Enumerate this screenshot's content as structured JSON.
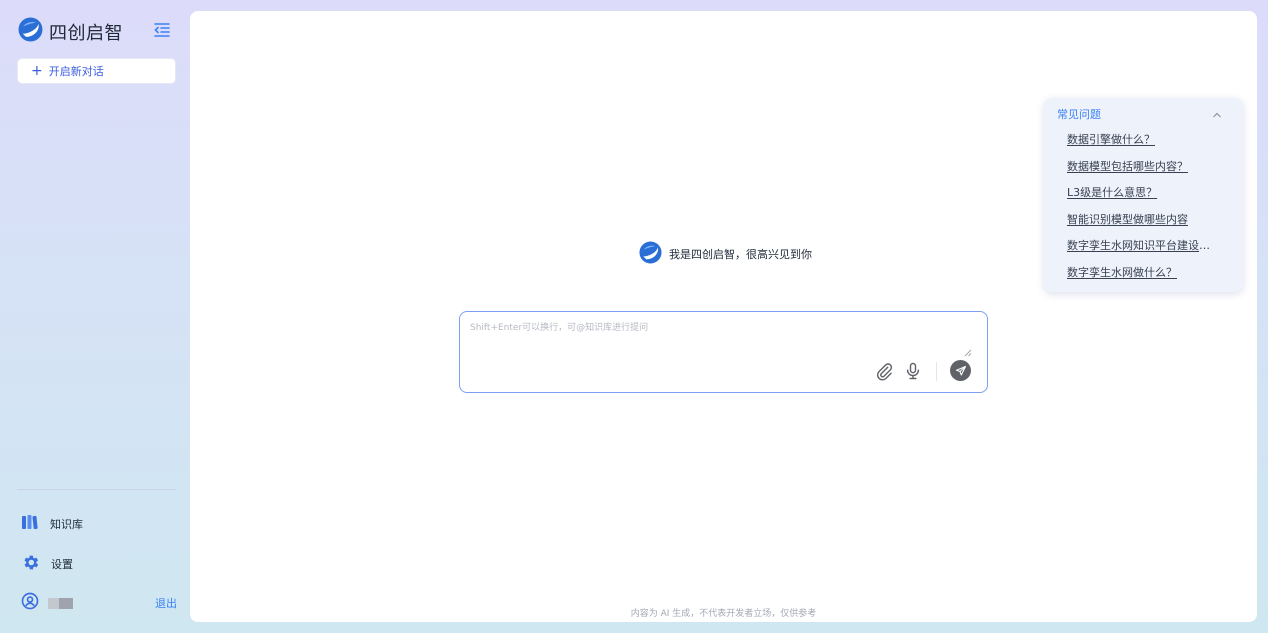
{
  "app": {
    "title": "四创启智"
  },
  "sidebar": {
    "new_chat_label": "开启新对话",
    "items": [
      {
        "label": "知识库",
        "icon": "book-icon"
      },
      {
        "label": "设置",
        "icon": "gear-icon"
      }
    ],
    "logout_label": "退出"
  },
  "main": {
    "welcome_text": "我是四创启智，很高兴见到你",
    "input": {
      "placeholder": "Shift+Enter可以换行，可@知识库进行提问",
      "value": ""
    },
    "footer_note": "内容为 AI 生成，不代表开发者立场，仅供参考"
  },
  "faq": {
    "title": "常见问题",
    "items": [
      "数据引擎做什么？",
      "数据模型包括哪些内容？",
      "L3级是什么意思？",
      "智能识别模型做哪些内容",
      "数字孪生水网知识平台建设包括哪些内容",
      "数字孪生水网做什么？"
    ]
  },
  "colors": {
    "accent": "#3b82f6",
    "logo_blue": "#2b6fd6",
    "input_border": "#7b9ef2",
    "send_button": "#5f6368"
  }
}
